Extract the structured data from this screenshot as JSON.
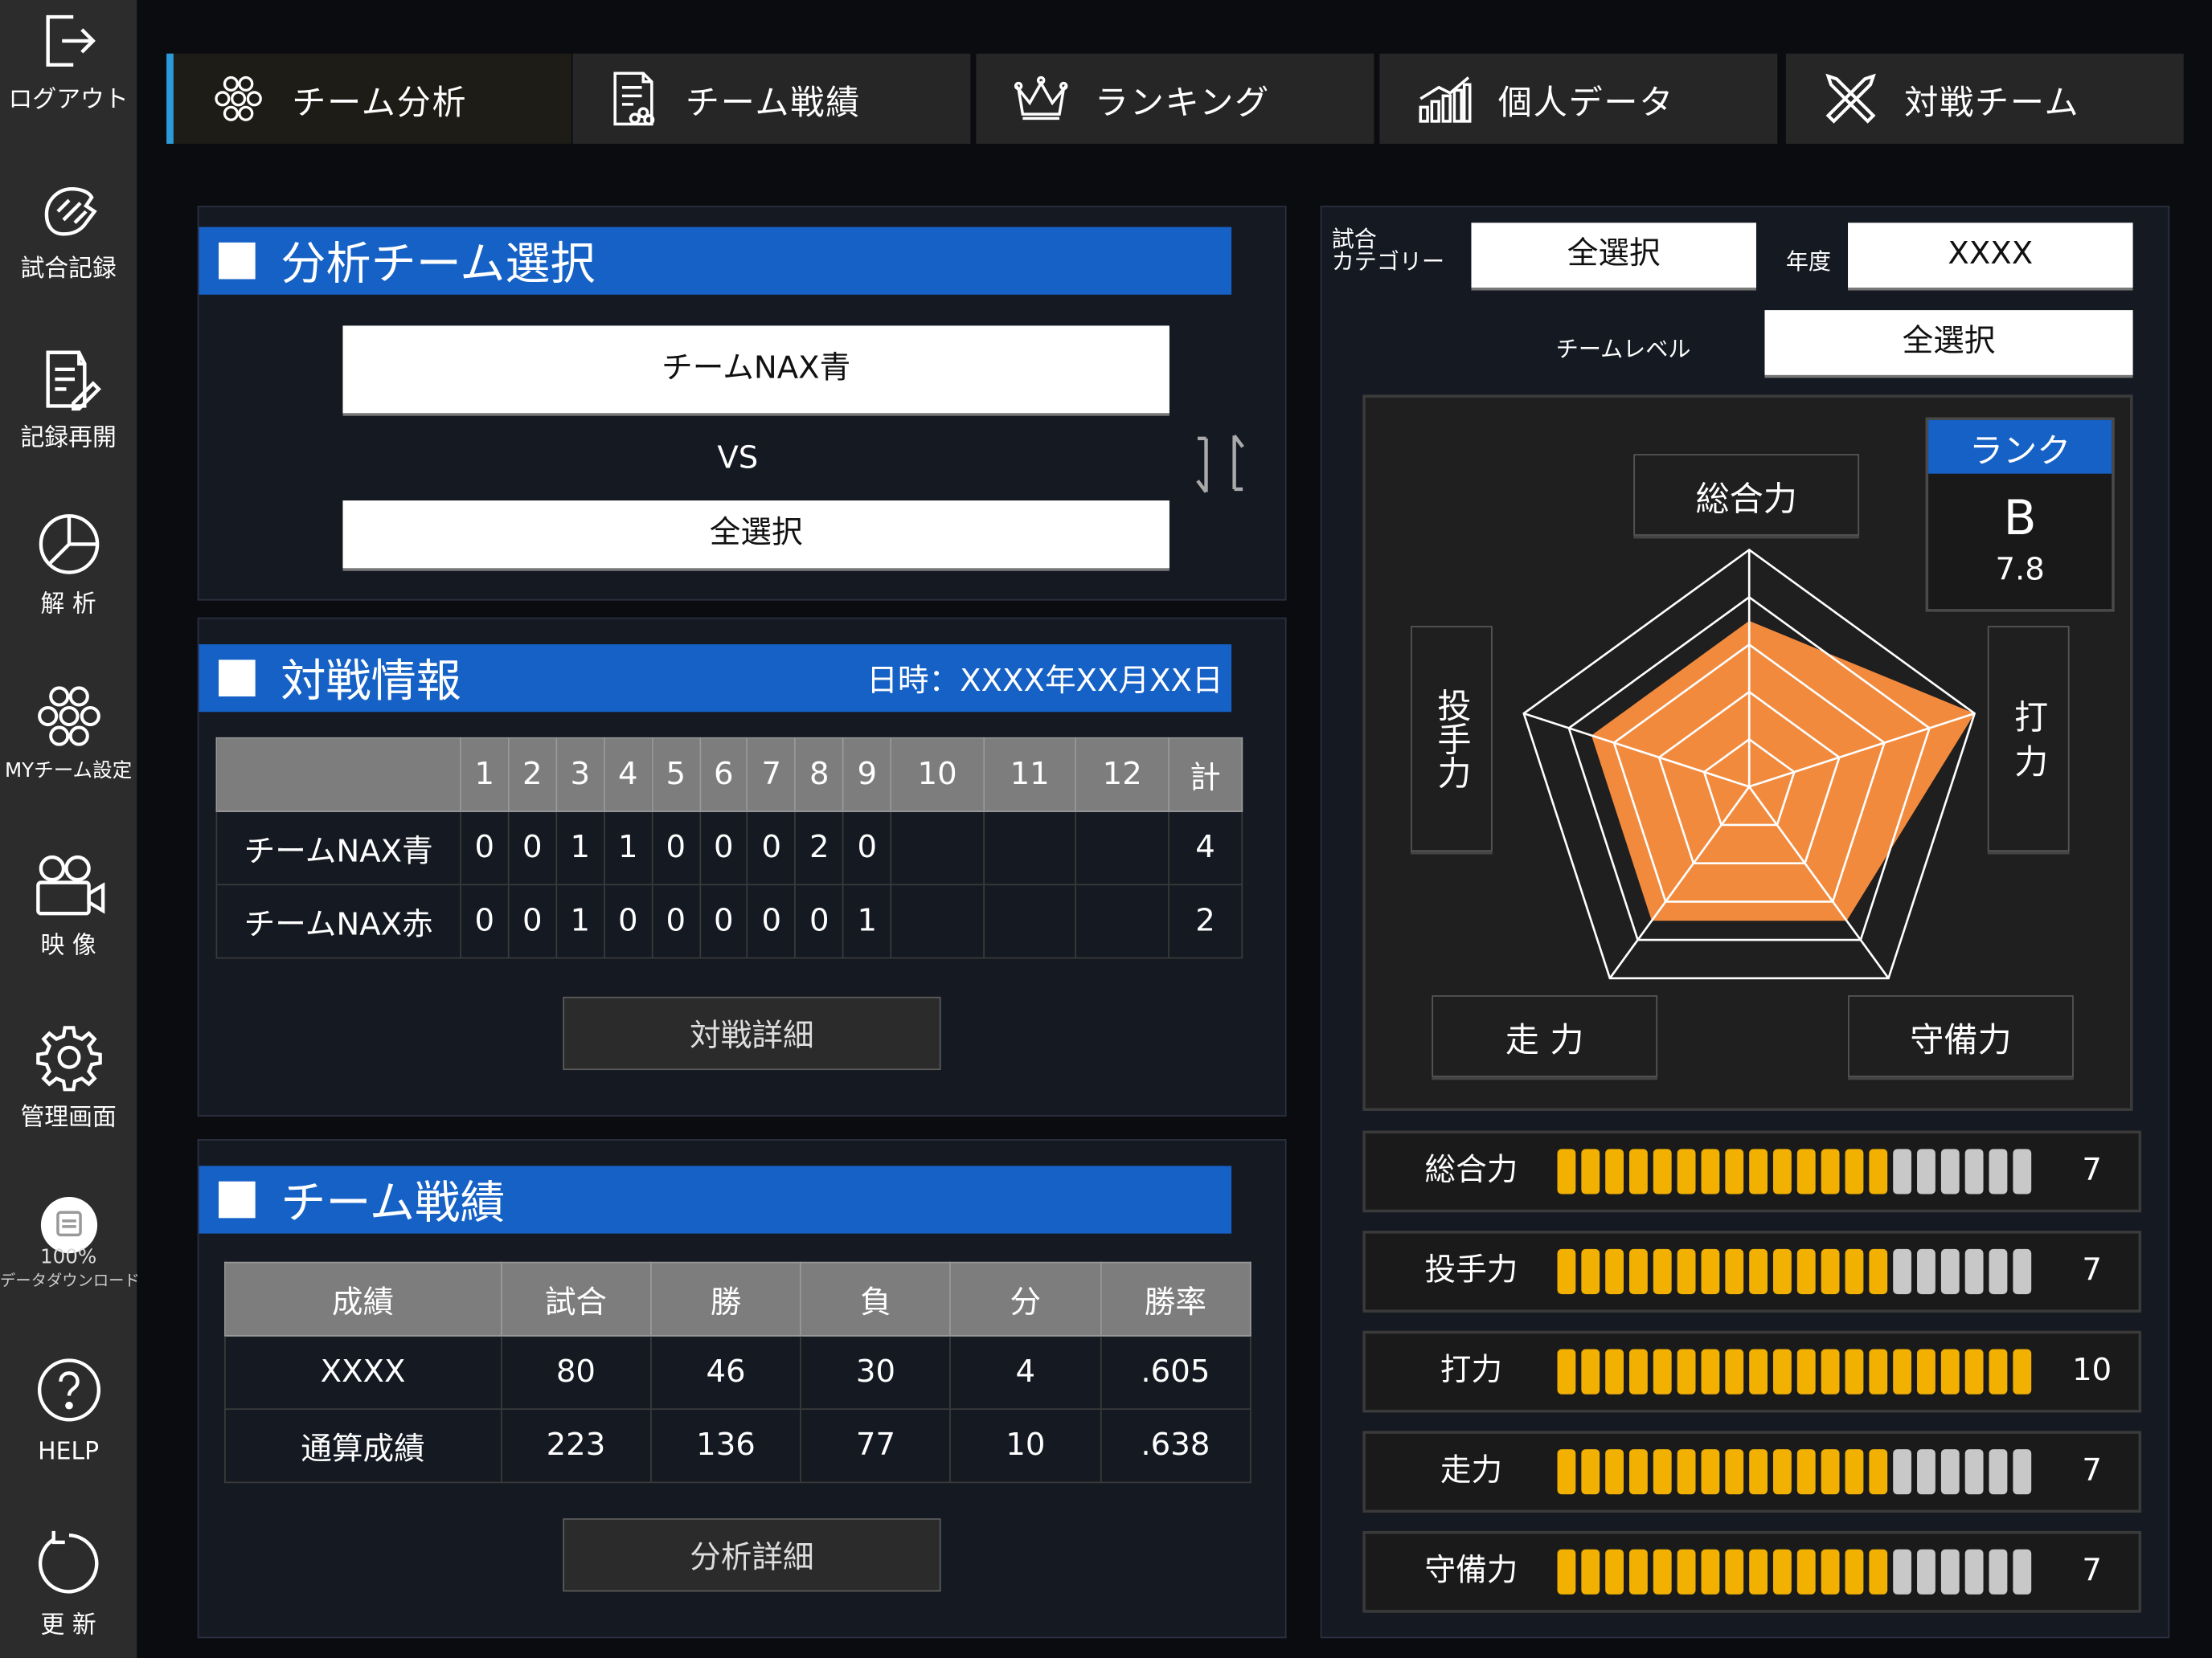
{
  "colors": {
    "accent_blue": "#1561c6",
    "gauge_on": "#f2b100",
    "gauge_off": "#c8c8c8",
    "radar_fill": "#f28a3e",
    "tab_indicator": "#2c9ad8"
  },
  "sidebar": {
    "items": [
      {
        "label": "ログアウト",
        "icon": "logout-icon"
      },
      {
        "label": "試合記録",
        "icon": "baseball-glove-icon"
      },
      {
        "label": "記録再開",
        "icon": "document-edit-icon"
      },
      {
        "label": "解 析",
        "icon": "pie-chart-icon"
      },
      {
        "label": "MYチーム設定",
        "icon": "team-icon"
      },
      {
        "label": "映 像",
        "icon": "video-camera-icon"
      },
      {
        "label": "管理画面",
        "icon": "gear-icon"
      },
      {
        "label": "データダウンロード",
        "icon": "download-icon",
        "progress": "100%"
      },
      {
        "label": "HELP",
        "icon": "help-icon"
      },
      {
        "label": "更 新",
        "icon": "refresh-icon"
      }
    ]
  },
  "tabs": [
    {
      "label": "チーム分析",
      "icon": "team-icon",
      "active": true
    },
    {
      "label": "チーム戦績",
      "icon": "report-icon",
      "active": false
    },
    {
      "label": "ランキング",
      "icon": "crown-icon",
      "active": false
    },
    {
      "label": "個人データ",
      "icon": "bar-chart-icon",
      "active": false
    },
    {
      "label": "対戦チーム",
      "icon": "crossed-bats-icon",
      "active": false
    }
  ],
  "team_select": {
    "title": "分析チーム選択",
    "team_a": "チームNAX青",
    "vs": "VS",
    "team_b": "全選択"
  },
  "match_info": {
    "title": "対戦情報",
    "date": "日時：XXXX年XX月XX日",
    "innings": [
      "1",
      "2",
      "3",
      "4",
      "5",
      "6",
      "7",
      "8",
      "9",
      "10",
      "11",
      "12",
      "計"
    ],
    "rows": [
      {
        "team": "チームNAX青",
        "scores": [
          "0",
          "0",
          "1",
          "1",
          "0",
          "0",
          "0",
          "2",
          "0",
          "",
          "",
          "",
          "4"
        ]
      },
      {
        "team": "チームNAX赤",
        "scores": [
          "0",
          "0",
          "1",
          "0",
          "0",
          "0",
          "0",
          "0",
          "1",
          "",
          "",
          "",
          "2"
        ]
      }
    ],
    "detail_button": "対戦詳細"
  },
  "team_record": {
    "title": "チーム戦績",
    "headers": [
      "成績",
      "試合",
      "勝",
      "負",
      "分",
      "勝率"
    ],
    "rows": [
      [
        "XXXX",
        "80",
        "46",
        "30",
        "4",
        ".605"
      ],
      [
        "通算成績",
        "223",
        "136",
        "77",
        "10",
        ".638"
      ]
    ],
    "detail_button": "分析詳細"
  },
  "filters": {
    "category_label": "試合\nカテゴリー",
    "category_value": "全選択",
    "year_label": "年度",
    "year_value": "XXXX",
    "level_label": "チームレベル",
    "level_value": "全選択"
  },
  "radar": {
    "axes": [
      "総合力",
      "打 力",
      "守備力",
      "走 力",
      "投手力"
    ],
    "values": [
      7,
      10,
      7,
      7,
      7
    ],
    "max": 10,
    "rank_title": "ランク",
    "rank_grade": "B",
    "rank_score": "7.8"
  },
  "gauges": [
    {
      "label": "総合力",
      "value": 7,
      "display": "7"
    },
    {
      "label": "投手力",
      "value": 7,
      "display": "7"
    },
    {
      "label": "打力",
      "value": 10,
      "display": "10"
    },
    {
      "label": "走力",
      "value": 7,
      "display": "7"
    },
    {
      "label": "守備力",
      "value": 7,
      "display": "7"
    }
  ],
  "gauge_max": 10
}
